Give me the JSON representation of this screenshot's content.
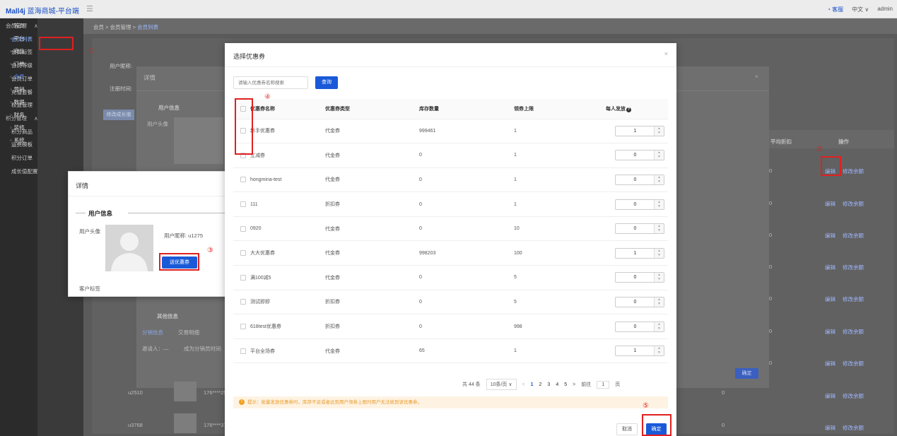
{
  "header": {
    "logo": "Mall4j",
    "app_name": "蓝海商城-平台端",
    "service": "客服",
    "language": "中文",
    "user": "admin"
  },
  "nav_primary": [
    {
      "label": "首页",
      "icon": "home-icon"
    },
    {
      "label": "平台",
      "icon": "platform-icon"
    },
    {
      "label": "商品",
      "icon": "product-icon"
    },
    {
      "label": "订单",
      "icon": "order-icon"
    },
    {
      "label": "会员",
      "icon": "member-icon"
    },
    {
      "label": "营销",
      "icon": "marketing-icon"
    },
    {
      "label": "数据",
      "icon": "data-icon"
    },
    {
      "label": "财务",
      "icon": "finance-icon"
    },
    {
      "label": "装修",
      "icon": "decor-icon"
    },
    {
      "label": "系统",
      "icon": "system-icon"
    }
  ],
  "nav_secondary": [
    {
      "label": "会员管理"
    },
    {
      "label": "会员列表"
    },
    {
      "label": "会员标签"
    },
    {
      "label": "会员等级"
    },
    {
      "label": "会员订单"
    },
    {
      "label": "充值套餐"
    },
    {
      "label": "权益管理"
    },
    {
      "label": "积分管理"
    },
    {
      "label": "积分商品"
    },
    {
      "label": "运费模板"
    },
    {
      "label": "积分订单"
    },
    {
      "label": "成长值配置"
    }
  ],
  "breadcrumb": {
    "a": "会员",
    "b": "会员管理",
    "c": "会员列表"
  },
  "background": {
    "filter_nickname": "用户昵称:",
    "filter_time": "注册时间:",
    "edit_tags": "修改成长值",
    "detail_title": "详情",
    "user_info": "用户信息",
    "user_avatar": "用户头像",
    "other_info": "其他信息",
    "tab_dist": "分销信息",
    "tab_trade": "交易明细",
    "inviter": "邀请人：—",
    "dist_time": "成为分销员时间:",
    "col_avg": "平均折扣",
    "col_op": "操作",
    "op_edit": "编辑",
    "op_balance": "修改余额",
    "ok": "确定",
    "rows": [
      {
        "id": "u2510",
        "phone": "176****25",
        "val": "0"
      },
      {
        "id": "u3768",
        "phone": "176****37",
        "val": "0"
      }
    ]
  },
  "card": {
    "title": "详情",
    "section": "用户信息",
    "avatar_label": "用户头像",
    "nickname": "用户昵称:  u1275",
    "send_btn": "送优惠券",
    "tags_label": "客户标签"
  },
  "modal": {
    "title": "选择优惠券",
    "search_placeholder": "请输入优惠券名称搜索",
    "query_btn": "查询",
    "headers": {
      "name": "优惠券名称",
      "type": "优惠券类型",
      "stock": "库存数量",
      "limit": "领券上限",
      "per": "每人发放"
    },
    "rows": [
      {
        "name": "新手优惠券",
        "type": "代金券",
        "stock": "999461",
        "limit": "1",
        "per": "1"
      },
      {
        "name": "立减券",
        "type": "代金券",
        "stock": "0",
        "limit": "1",
        "per": "0"
      },
      {
        "name": "hongmina-test",
        "type": "代金券",
        "stock": "0",
        "limit": "1",
        "per": "0"
      },
      {
        "name": "111",
        "type": "折扣券",
        "stock": "0",
        "limit": "1",
        "per": "0"
      },
      {
        "name": "0920",
        "type": "代金券",
        "stock": "0",
        "limit": "10",
        "per": "0"
      },
      {
        "name": "大大优惠券",
        "type": "代金券",
        "stock": "998203",
        "limit": "100",
        "per": "1"
      },
      {
        "name": "满100减5",
        "type": "代金券",
        "stock": "0",
        "limit": "5",
        "per": "0"
      },
      {
        "name": "测试即即",
        "type": "折扣券",
        "stock": "0",
        "limit": "5",
        "per": "0"
      },
      {
        "name": "618test优惠券",
        "type": "折扣券",
        "stock": "0",
        "limit": "998",
        "per": "0"
      },
      {
        "name": "平台全场券",
        "type": "代金券",
        "stock": "65",
        "limit": "1",
        "per": "1"
      }
    ],
    "pager": {
      "total": "共 44 条",
      "size": "10条/页",
      "prev": "<",
      "pages": [
        "1",
        "2",
        "3",
        "4",
        "5"
      ],
      "next": ">",
      "goto": "前往",
      "page": "1",
      "page_unit": "页"
    },
    "tip": "提示：批量发放优惠券时，库存不足或者达到用户领券上限时用户无法收到该优惠券。",
    "cancel": "取消",
    "ok": "确定"
  },
  "annotations": {
    "n1": "①",
    "n2": "②",
    "n3": "③",
    "n4": "④",
    "n5": "⑤"
  }
}
